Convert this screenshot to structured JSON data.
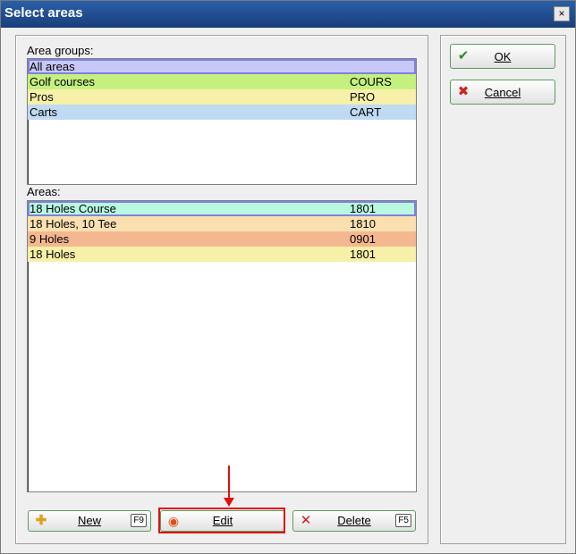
{
  "window": {
    "title": "Select areas",
    "close_glyph": "×"
  },
  "area_groups": {
    "label": "Area groups:",
    "rows": [
      {
        "name": "All areas",
        "code": "",
        "color": "#c8c8f8",
        "selected": true
      },
      {
        "name": "Golf courses",
        "code": "COURS",
        "color": "#c4f080",
        "selected": false
      },
      {
        "name": "Pros",
        "code": "PRO",
        "color": "#f6f0a8",
        "selected": false
      },
      {
        "name": "Carts",
        "code": "CART",
        "color": "#c0daf4",
        "selected": false
      }
    ]
  },
  "areas": {
    "label": "Areas:",
    "rows": [
      {
        "name": "18 Holes Course",
        "code": "1801",
        "color": "#b8f8e0",
        "selected": true
      },
      {
        "name": "18 Holes, 10 Tee",
        "code": "1810",
        "color": "#fae0b0",
        "selected": false
      },
      {
        "name": "9 Holes",
        "code": "0901",
        "color": "#f4b890",
        "selected": false
      },
      {
        "name": "18 Holes",
        "code": "1801",
        "color": "#f6f0a8",
        "selected": false
      }
    ]
  },
  "buttons": {
    "ok": {
      "label": "OK",
      "icon": "check-icon"
    },
    "cancel": {
      "label": "Cancel",
      "icon": "x-icon"
    },
    "new": {
      "label": "New",
      "key": "F9",
      "icon": "plus-icon"
    },
    "edit": {
      "label": "Edit",
      "icon": "ring-icon"
    },
    "delete": {
      "label": "Delete",
      "key": "F5",
      "icon": "x-icon"
    }
  },
  "colors": {
    "highlight": "#e01010",
    "button_border": "#5d9a5d"
  }
}
